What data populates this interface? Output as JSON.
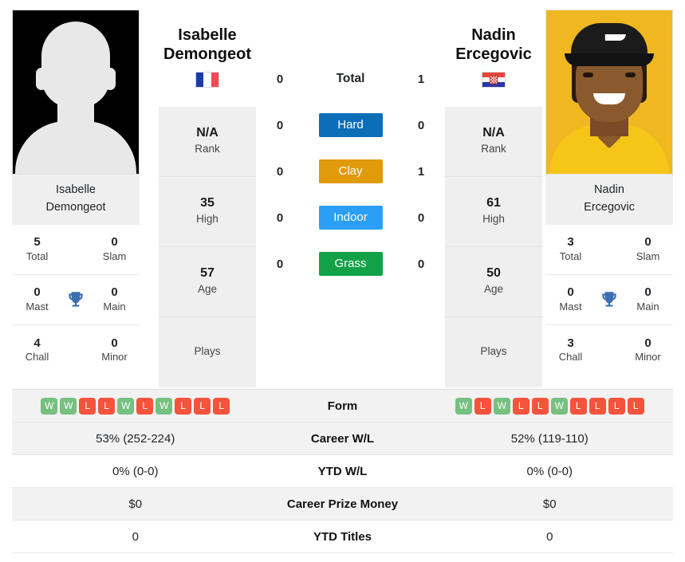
{
  "players": {
    "left": {
      "name_line1": "Isabelle",
      "name_line2": "Demongeot",
      "caption_line1": "Isabelle",
      "caption_line2": "Demongeot",
      "flag": "france-flag",
      "photo": "placeholder-silhouette-photo",
      "rank": "N/A",
      "rank_label": "Rank",
      "high": "35",
      "high_label": "High",
      "age": "57",
      "age_label": "Age",
      "plays": "Plays",
      "titles": {
        "total": "5",
        "total_label": "Total",
        "slam": "0",
        "slam_label": "Slam",
        "mast": "0",
        "mast_label": "Mast",
        "main": "0",
        "main_label": "Main",
        "chall": "4",
        "chall_label": "Chall",
        "minor": "0",
        "minor_label": "Minor"
      },
      "form": [
        "W",
        "W",
        "L",
        "L",
        "W",
        "L",
        "W",
        "L",
        "L",
        "L"
      ],
      "career_wl": "53% (252-224)",
      "ytd_wl": "0% (0-0)",
      "career_prize_money": "$0",
      "ytd_titles": "0"
    },
    "right": {
      "name_line1": "Nadin",
      "name_line2": "Ercegovic",
      "caption_line1": "Nadin",
      "caption_line2": "Ercegovic",
      "flag": "croatia-flag",
      "photo": "player-portrait-photo",
      "rank": "N/A",
      "rank_label": "Rank",
      "high": "61",
      "high_label": "High",
      "age": "50",
      "age_label": "Age",
      "plays": "Plays",
      "titles": {
        "total": "3",
        "total_label": "Total",
        "slam": "0",
        "slam_label": "Slam",
        "mast": "0",
        "mast_label": "Mast",
        "main": "0",
        "main_label": "Main",
        "chall": "3",
        "chall_label": "Chall",
        "minor": "0",
        "minor_label": "Minor"
      },
      "form": [
        "W",
        "L",
        "W",
        "L",
        "L",
        "W",
        "L",
        "L",
        "L",
        "L"
      ],
      "career_wl": "52% (119-110)",
      "ytd_wl": "0% (0-0)",
      "career_prize_money": "$0",
      "ytd_titles": "0"
    }
  },
  "h2h": {
    "total": {
      "label": "Total",
      "left": "0",
      "right": "1"
    },
    "surfaces": [
      {
        "label": "Hard",
        "left": "0",
        "right": "0",
        "color": "#0d6eb8"
      },
      {
        "label": "Clay",
        "left": "0",
        "right": "1",
        "color": "#e09a0a"
      },
      {
        "label": "Indoor",
        "left": "0",
        "right": "0",
        "color": "#2b9ff5"
      },
      {
        "label": "Grass",
        "left": "0",
        "right": "0",
        "color": "#12a147"
      }
    ]
  },
  "table": {
    "rows": [
      {
        "label": "Form",
        "left": "",
        "right": ""
      },
      {
        "label": "Career W/L",
        "left": "53% (252-224)",
        "right": "52% (119-110)"
      },
      {
        "label": "YTD W/L",
        "left": "0% (0-0)",
        "right": "0% (0-0)"
      },
      {
        "label": "Career Prize Money",
        "left": "$0",
        "right": "$0"
      },
      {
        "label": "YTD Titles",
        "left": "0",
        "right": "0"
      }
    ]
  },
  "colors": {
    "hard": "#0d6eb8",
    "clay": "#e09a0a",
    "indoor": "#2b9ff5",
    "grass": "#12a147",
    "win": "#76c080",
    "loss": "#f4533c",
    "trophy": "#3b6fb0",
    "panel": "#efefef"
  }
}
